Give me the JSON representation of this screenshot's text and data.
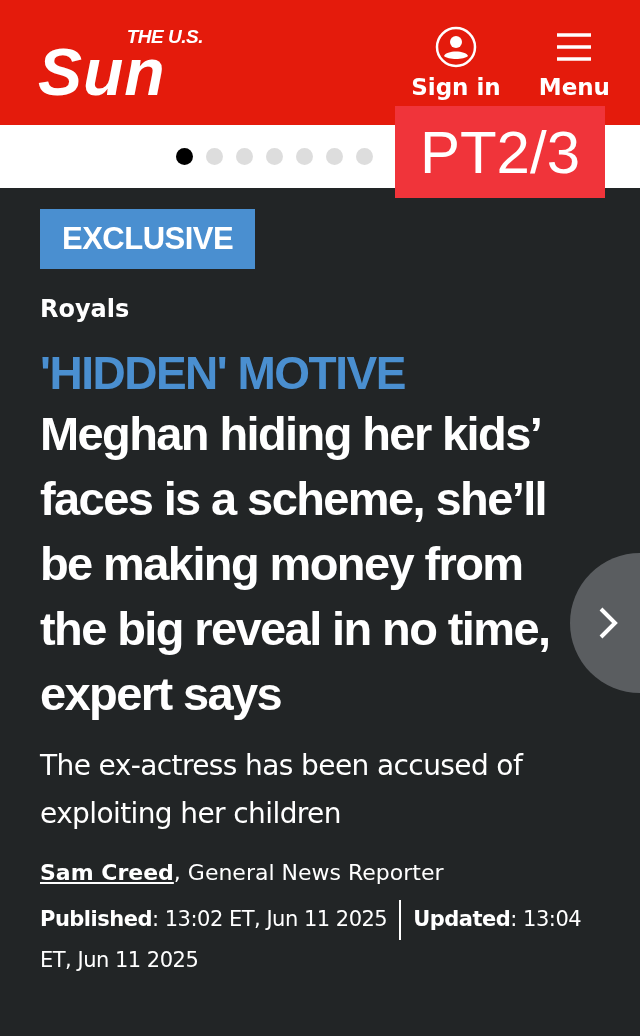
{
  "header": {
    "logo": {
      "small": "THE U.S.",
      "big": "Sun"
    },
    "sign_in": "Sign in",
    "menu": "Menu"
  },
  "carousel_dots": [
    {
      "selected": true
    },
    {
      "selected": false
    },
    {
      "selected": false
    },
    {
      "selected": false
    },
    {
      "selected": false
    },
    {
      "selected": false
    },
    {
      "selected": false
    }
  ],
  "overlay_label": "PT2/3",
  "article": {
    "badge": "EXCLUSIVE",
    "section": "Royals",
    "kicker": "'HIDDEN' MOTIVE",
    "headline": "Meghan hiding her kids’ faces is a scheme, she’ll be making money from the big reveal in no time, expert says",
    "standfirst": "The ex-actress has been accused of exploiting her children",
    "author": "Sam Creed",
    "author_role": ", General News Reporter",
    "published_label": "Published",
    "published": ": 13:02 ET, Jun 11 2025",
    "updated_label": "Updated",
    "updated": ": 13:04 ET, Jun 11 2025"
  }
}
